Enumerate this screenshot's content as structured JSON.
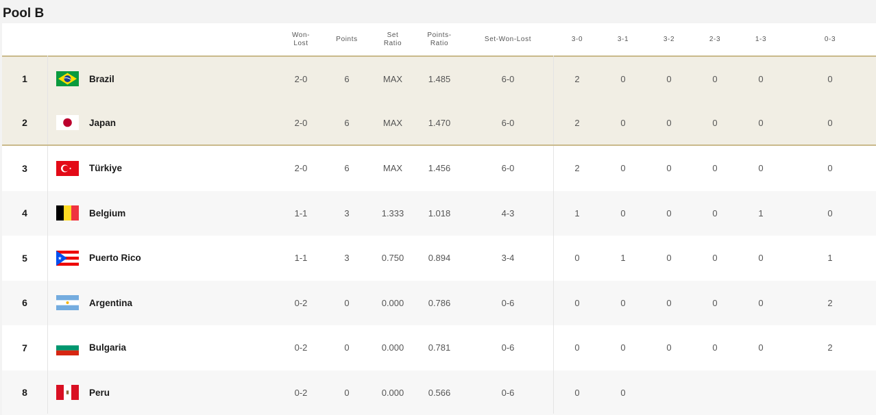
{
  "page": {
    "title": "Pool B"
  },
  "headers": {
    "won_lost": [
      "Won-",
      "Lost"
    ],
    "points": "Points",
    "set_ratio": [
      "Set",
      "Ratio"
    ],
    "points_ratio": [
      "Points-",
      "Ratio"
    ],
    "set_won_lost": "Set-Won-Lost",
    "r30": "3-0",
    "r31": "3-1",
    "r32": "3-2",
    "r23": "2-3",
    "r13": "1-3",
    "r03": "0-3"
  },
  "colors": {
    "qualified_bg": "#f1eee4",
    "qualified_border": "#c9b98a",
    "row_alt": "#f7f7f7",
    "row_white": "#ffffff"
  },
  "rows": [
    {
      "rank": "1",
      "team": "Brazil",
      "flag": "flag-brazil-icon",
      "wl": "2-0",
      "pts": "6",
      "sr": "MAX",
      "pr": "1.485",
      "swl": "6-0",
      "r30": "2",
      "r31": "0",
      "r32": "0",
      "r23": "0",
      "r13": "0",
      "r03": "0"
    },
    {
      "rank": "2",
      "team": "Japan",
      "flag": "flag-japan-icon",
      "wl": "2-0",
      "pts": "6",
      "sr": "MAX",
      "pr": "1.470",
      "swl": "6-0",
      "r30": "2",
      "r31": "0",
      "r32": "0",
      "r23": "0",
      "r13": "0",
      "r03": "0"
    },
    {
      "rank": "3",
      "team": "Türkiye",
      "flag": "flag-turkiye-icon",
      "wl": "2-0",
      "pts": "6",
      "sr": "MAX",
      "pr": "1.456",
      "swl": "6-0",
      "r30": "2",
      "r31": "0",
      "r32": "0",
      "r23": "0",
      "r13": "0",
      "r03": "0"
    },
    {
      "rank": "4",
      "team": "Belgium",
      "flag": "flag-belgium-icon",
      "wl": "1-1",
      "pts": "3",
      "sr": "1.333",
      "pr": "1.018",
      "swl": "4-3",
      "r30": "1",
      "r31": "0",
      "r32": "0",
      "r23": "0",
      "r13": "1",
      "r03": "0"
    },
    {
      "rank": "5",
      "team": "Puerto Rico",
      "flag": "flag-puerto-rico-icon",
      "wl": "1-1",
      "pts": "3",
      "sr": "0.750",
      "pr": "0.894",
      "swl": "3-4",
      "r30": "0",
      "r31": "1",
      "r32": "0",
      "r23": "0",
      "r13": "0",
      "r03": "1"
    },
    {
      "rank": "6",
      "team": "Argentina",
      "flag": "flag-argentina-icon",
      "wl": "0-2",
      "pts": "0",
      "sr": "0.000",
      "pr": "0.786",
      "swl": "0-6",
      "r30": "0",
      "r31": "0",
      "r32": "0",
      "r23": "0",
      "r13": "0",
      "r03": "2"
    },
    {
      "rank": "7",
      "team": "Bulgaria",
      "flag": "flag-bulgaria-icon",
      "wl": "0-2",
      "pts": "0",
      "sr": "0.000",
      "pr": "0.781",
      "swl": "0-6",
      "r30": "0",
      "r31": "0",
      "r32": "0",
      "r23": "0",
      "r13": "0",
      "r03": "2"
    },
    {
      "rank": "8",
      "team": "Peru",
      "flag": "flag-peru-icon",
      "wl": "0-2",
      "pts": "0",
      "sr": "0.000",
      "pr": "0.566",
      "swl": "0-6",
      "r30": "0",
      "r31": "0"
    }
  ]
}
